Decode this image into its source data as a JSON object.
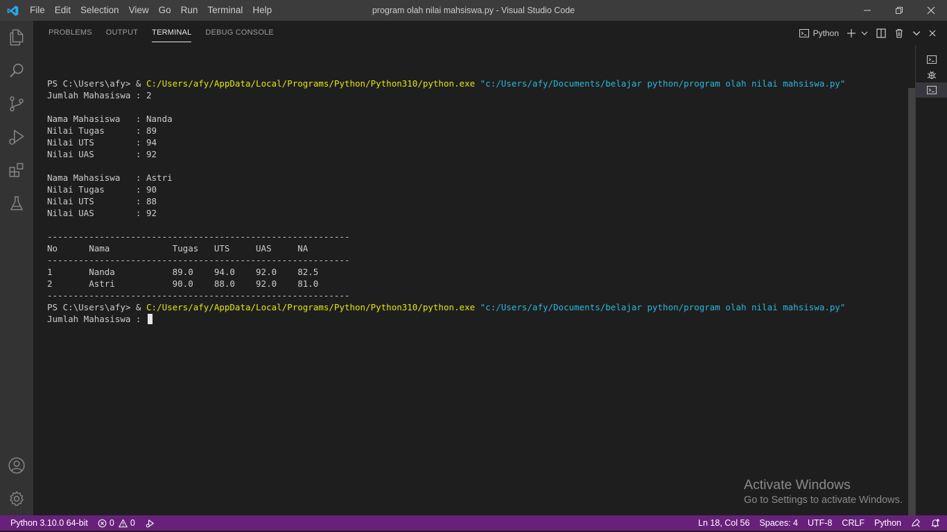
{
  "app": {
    "window_title": "program olah nilai mahsiswa.py - Visual Studio Code"
  },
  "menu": [
    "File",
    "Edit",
    "Selection",
    "View",
    "Go",
    "Run",
    "Terminal",
    "Help"
  ],
  "panel": {
    "tabs": [
      "PROBLEMS",
      "OUTPUT",
      "TERMINAL",
      "DEBUG CONSOLE"
    ],
    "active_tab": "TERMINAL",
    "terminal_profile": "Python"
  },
  "terminal": {
    "lines": [
      {
        "segments": [
          {
            "text": "",
            "color": "default"
          }
        ]
      },
      {
        "segments": [
          {
            "text": "PS C:\\Users\\afy> & ",
            "color": "default"
          },
          {
            "text": "C:/Users/afy/AppData/Local/Programs/Python/Python310/python.exe",
            "color": "yellow"
          },
          {
            "text": " ",
            "color": "default"
          },
          {
            "text": "\"c:/Users/afy/Documents/belajar python/program olah nilai mahsiswa.py\"",
            "color": "cyan"
          }
        ]
      },
      {
        "segments": [
          {
            "text": "Jumlah Mahasiswa : 2",
            "color": "default"
          }
        ]
      },
      {
        "segments": [
          {
            "text": "",
            "color": "default"
          }
        ]
      },
      {
        "segments": [
          {
            "text": "Nama Mahasiswa   : Nanda",
            "color": "default"
          }
        ]
      },
      {
        "segments": [
          {
            "text": "Nilai Tugas      : 89",
            "color": "default"
          }
        ]
      },
      {
        "segments": [
          {
            "text": "Nilai UTS        : 94",
            "color": "default"
          }
        ]
      },
      {
        "segments": [
          {
            "text": "Nilai UAS        : 92",
            "color": "default"
          }
        ]
      },
      {
        "segments": [
          {
            "text": "",
            "color": "default"
          }
        ]
      },
      {
        "segments": [
          {
            "text": "Nama Mahasiswa   : Astri",
            "color": "default"
          }
        ]
      },
      {
        "segments": [
          {
            "text": "Nilai Tugas      : 90",
            "color": "default"
          }
        ]
      },
      {
        "segments": [
          {
            "text": "Nilai UTS        : 88",
            "color": "default"
          }
        ]
      },
      {
        "segments": [
          {
            "text": "Nilai UAS        : 92",
            "color": "default"
          }
        ]
      },
      {
        "segments": [
          {
            "text": "",
            "color": "default"
          }
        ]
      },
      {
        "segments": [
          {
            "text": "----------------------------------------------------------",
            "color": "default"
          }
        ]
      },
      {
        "segments": [
          {
            "text": "No      Nama            Tugas   UTS     UAS     NA",
            "color": "default"
          }
        ]
      },
      {
        "segments": [
          {
            "text": "----------------------------------------------------------",
            "color": "default"
          }
        ]
      },
      {
        "segments": [
          {
            "text": "1       Nanda           89.0    94.0    92.0    82.5",
            "color": "default"
          }
        ]
      },
      {
        "segments": [
          {
            "text": "2       Astri           90.0    88.0    92.0    81.0",
            "color": "default"
          }
        ]
      },
      {
        "segments": [
          {
            "text": "----------------------------------------------------------",
            "color": "default"
          }
        ]
      },
      {
        "segments": [
          {
            "text": "PS C:\\Users\\afy> & ",
            "color": "default"
          },
          {
            "text": "C:/Users/afy/AppData/Local/Programs/Python/Python310/python.exe",
            "color": "yellow"
          },
          {
            "text": " ",
            "color": "default"
          },
          {
            "text": "\"c:/Users/afy/Documents/belajar python/program olah nilai mahsiswa.py\"",
            "color": "cyan"
          }
        ]
      },
      {
        "segments": [
          {
            "text": "Jumlah Mahasiswa : ",
            "color": "default"
          }
        ],
        "cursor": true
      }
    ]
  },
  "watermark": {
    "title": "Activate Windows",
    "subtitle": "Go to Settings to activate Windows."
  },
  "statusbar": {
    "interpreter": "Python 3.10.0 64-bit",
    "errors": "0",
    "warnings": "0",
    "position": "Ln 18, Col 56",
    "spaces": "Spaces: 4",
    "encoding": "UTF-8",
    "eol": "CRLF",
    "language": "Python"
  },
  "colors": {
    "titlebar": "#3c3c3c",
    "activitybar": "#333333",
    "editor_bg": "#1e1e1e",
    "statusbar": "#68217a",
    "terminal_yellow": "#e5e510",
    "terminal_cyan": "#29b8db"
  },
  "icons": {
    "logo": "vscode-logo-icon",
    "activity": [
      "explorer-icon",
      "search-icon",
      "source-control-icon",
      "run-debug-icon",
      "extensions-icon",
      "testing-icon"
    ],
    "activity_bottom": [
      "account-icon",
      "settings-gear-icon"
    ]
  }
}
